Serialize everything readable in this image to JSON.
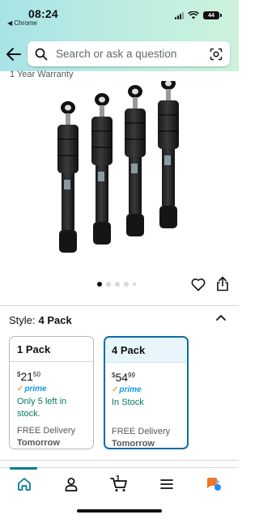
{
  "status_bar": {
    "time": "08:24",
    "back_app": "◀ Chrome",
    "battery": "44"
  },
  "search": {
    "placeholder": "Search or ask a question"
  },
  "product": {
    "warranty_text": "1 Year Warranty",
    "image_dots": 5,
    "active_dot": 1
  },
  "style_selector": {
    "label": "Style:",
    "selected": "4 Pack",
    "options": [
      {
        "title": "1 Pack",
        "currency": "$",
        "price_whole": "21",
        "price_fraction": "50",
        "prime_label": "prime",
        "stock": "Only 5 left in stock.",
        "delivery": "FREE Delivery",
        "delivery_day": "Tomorrow",
        "selected": false
      },
      {
        "title": "4 Pack",
        "currency": "$",
        "price_whole": "54",
        "price_fraction": "99",
        "prime_label": "prime",
        "stock": "In Stock",
        "delivery": "FREE Delivery",
        "delivery_day": "Tomorrow",
        "selected": true
      }
    ]
  },
  "bottom_nav": {
    "cart_count": "1",
    "items": [
      "home-icon",
      "account-icon",
      "cart-icon",
      "menu-icon",
      "rufus-ai-icon"
    ]
  },
  "colors": {
    "accent": "#0a6ea8",
    "stock_green": "#067d62",
    "prime_blue": "#1399e1",
    "nav_active": "#0a7b91"
  }
}
